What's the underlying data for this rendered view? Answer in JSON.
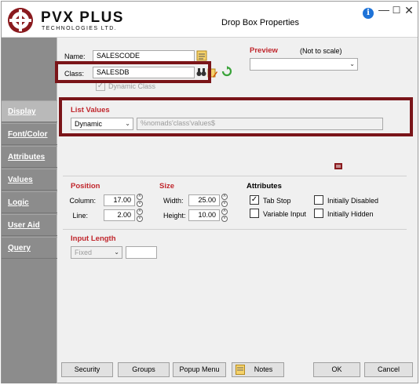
{
  "window": {
    "title": "Drop Box Properties",
    "logo_text": "PVX PLUS",
    "logo_sub": "TECHNOLOGIES LTD."
  },
  "sidebar": {
    "items": [
      {
        "label": "Display",
        "active": true
      },
      {
        "label": "Font/Color",
        "active": false
      },
      {
        "label": "Attributes",
        "active": false
      },
      {
        "label": "Values",
        "active": false
      },
      {
        "label": "Logic",
        "active": false
      },
      {
        "label": "User Aid",
        "active": false
      },
      {
        "label": "Query",
        "active": false
      }
    ]
  },
  "header_fields": {
    "name_label": "Name:",
    "name_value": "SALESCODE",
    "class_label": "Class:",
    "class_value": "SALESDB",
    "dynamic_class_label": "Dynamic Class",
    "dynamic_class_checked": true
  },
  "preview": {
    "title": "Preview",
    "note": "(Not to scale)",
    "value": ""
  },
  "list_values": {
    "title": "List Values",
    "mode": "Dynamic",
    "expression": "%nomads'class'values$"
  },
  "position": {
    "title": "Position",
    "column_label": "Column:",
    "column_value": "17.00",
    "line_label": "Line:",
    "line_value": "2.00"
  },
  "size": {
    "title": "Size",
    "width_label": "Width:",
    "width_value": "25.00",
    "height_label": "Height:",
    "height_value": "10.00"
  },
  "attributes": {
    "title": "Attributes",
    "tab_stop": {
      "label": "Tab Stop",
      "checked": true
    },
    "variable_input": {
      "label": "Variable Input",
      "checked": false
    },
    "initially_disabled": {
      "label": "Initially Disabled",
      "checked": false
    },
    "initially_hidden": {
      "label": "Initially Hidden",
      "checked": false
    }
  },
  "input_length": {
    "title": "Input Length",
    "mode": "Fixed",
    "value": ""
  },
  "buttons": {
    "security": "Security",
    "groups": "Groups",
    "popup_menu": "Popup Menu",
    "notes": "Notes",
    "ok": "OK",
    "cancel": "Cancel"
  },
  "colors": {
    "accent_red": "#c0262c",
    "highlight_border": "#7a1519",
    "sidebar_bg": "#8c8c8c"
  }
}
